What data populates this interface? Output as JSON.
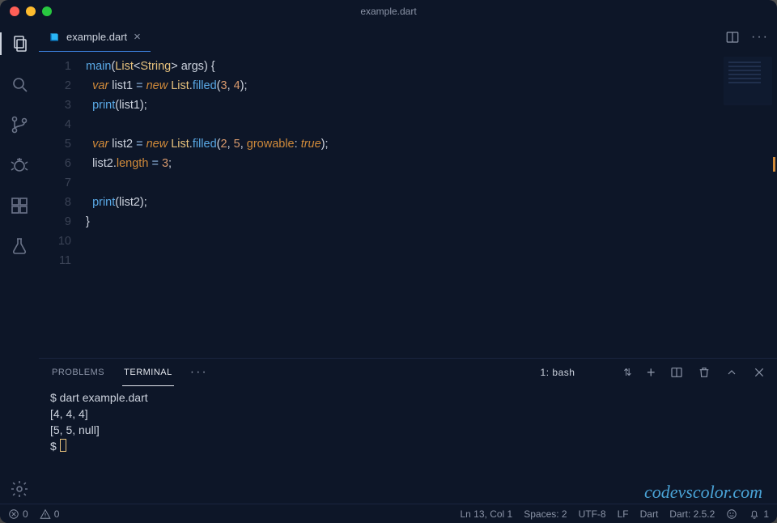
{
  "window": {
    "title": "example.dart"
  },
  "tab": {
    "label": "example.dart"
  },
  "activitybar": {
    "items": [
      "explorer",
      "search",
      "source-control",
      "debug",
      "extensions",
      "experiments"
    ]
  },
  "editor": {
    "lineNumbers": [
      "1",
      "2",
      "3",
      "4",
      "5",
      "6",
      "7",
      "8",
      "9",
      "10",
      "11"
    ],
    "lines": [
      [
        [
          "fn",
          "main"
        ],
        [
          "punc",
          "("
        ],
        [
          "type",
          "List"
        ],
        [
          "punc",
          "<"
        ],
        [
          "type",
          "String"
        ],
        [
          "punc",
          "> "
        ],
        [
          "var",
          "args"
        ],
        [
          "punc",
          ") {"
        ]
      ],
      [
        [
          "",
          "  "
        ],
        [
          "kw",
          "var"
        ],
        [
          "",
          " "
        ],
        [
          "var",
          "list1"
        ],
        [
          "",
          " "
        ],
        [
          "op",
          "="
        ],
        [
          "",
          " "
        ],
        [
          "kw",
          "new"
        ],
        [
          "",
          " "
        ],
        [
          "type",
          "List"
        ],
        [
          "punc",
          "."
        ],
        [
          "fn",
          "filled"
        ],
        [
          "punc",
          "("
        ],
        [
          "num",
          "3"
        ],
        [
          "punc",
          ", "
        ],
        [
          "num",
          "4"
        ],
        [
          "punc",
          ");"
        ]
      ],
      [
        [
          "",
          "  "
        ],
        [
          "fn",
          "print"
        ],
        [
          "punc",
          "("
        ],
        [
          "var",
          "list1"
        ],
        [
          "punc",
          ");"
        ]
      ],
      [
        [
          "",
          ""
        ]
      ],
      [
        [
          "",
          "  "
        ],
        [
          "kw",
          "var"
        ],
        [
          "",
          " "
        ],
        [
          "var",
          "list2"
        ],
        [
          "",
          " "
        ],
        [
          "op",
          "="
        ],
        [
          "",
          " "
        ],
        [
          "kw",
          "new"
        ],
        [
          "",
          " "
        ],
        [
          "type",
          "List"
        ],
        [
          "punc",
          "."
        ],
        [
          "fn",
          "filled"
        ],
        [
          "punc",
          "("
        ],
        [
          "num",
          "2"
        ],
        [
          "punc",
          ", "
        ],
        [
          "num",
          "5"
        ],
        [
          "punc",
          ", "
        ],
        [
          "prop",
          "growable"
        ],
        [
          "punc",
          ": "
        ],
        [
          "bool",
          "true"
        ],
        [
          "punc",
          ");"
        ]
      ],
      [
        [
          "",
          "  "
        ],
        [
          "var",
          "list2"
        ],
        [
          "punc",
          "."
        ],
        [
          "prop",
          "length"
        ],
        [
          "",
          " "
        ],
        [
          "op",
          "="
        ],
        [
          "",
          " "
        ],
        [
          "num",
          "3"
        ],
        [
          "punc",
          ";"
        ]
      ],
      [
        [
          "",
          ""
        ]
      ],
      [
        [
          "",
          "  "
        ],
        [
          "fn",
          "print"
        ],
        [
          "punc",
          "("
        ],
        [
          "var",
          "list2"
        ],
        [
          "punc",
          ");"
        ]
      ],
      [
        [
          "punc",
          "}"
        ]
      ],
      [
        [
          "",
          ""
        ]
      ],
      [
        [
          "",
          ""
        ]
      ]
    ]
  },
  "panel": {
    "tabs": {
      "problems": "PROBLEMS",
      "terminal": "TERMINAL"
    },
    "terminalSelect": "1: bash",
    "output": [
      "$ dart example.dart",
      "[4, 4, 4]",
      "[5, 5, null]",
      "$ "
    ]
  },
  "watermark": "codevscolor.com",
  "status": {
    "errors": "0",
    "warnings": "0",
    "cursor": "Ln 13, Col 1",
    "spaces": "Spaces: 2",
    "encoding": "UTF-8",
    "eol": "LF",
    "lang": "Dart",
    "sdk": "Dart: 2.5.2",
    "bell": "1"
  }
}
